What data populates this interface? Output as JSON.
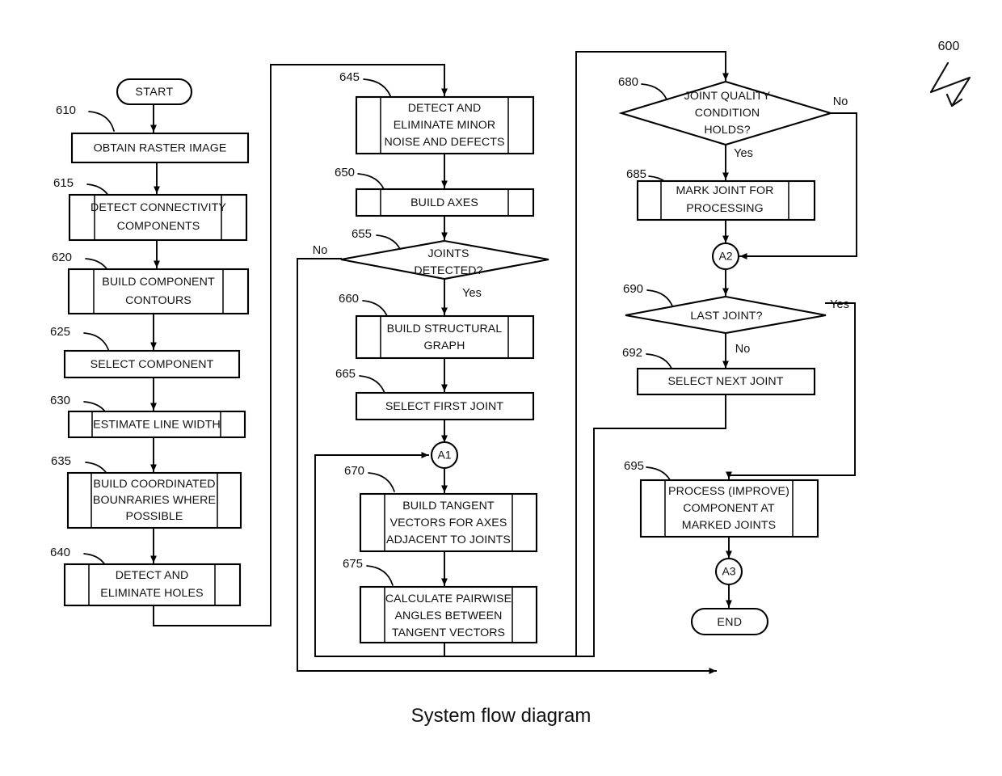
{
  "figure": {
    "number": "600",
    "caption": "System flow diagram"
  },
  "terminators": {
    "start": "START",
    "end": "END"
  },
  "connectors": [
    {
      "id": "A1",
      "label": "A1"
    },
    {
      "id": "A2",
      "label": "A2"
    },
    {
      "id": "A3",
      "label": "A3"
    }
  ],
  "edge_labels": {
    "joints_detected_no": "No",
    "joints_detected_yes": "Yes",
    "joint_quality_no": "No",
    "joint_quality_yes": "Yes",
    "last_joint_yes": "Yes",
    "last_joint_no": "No"
  },
  "nodes": [
    {
      "ref": "610",
      "shape": "process",
      "lines": [
        "OBTAIN RASTER IMAGE"
      ]
    },
    {
      "ref": "615",
      "shape": "predefined",
      "lines": [
        "DETECT CONNECTIVITY",
        "COMPONENTS"
      ]
    },
    {
      "ref": "620",
      "shape": "predefined",
      "lines": [
        "BUILD COMPONENT",
        "CONTOURS"
      ]
    },
    {
      "ref": "625",
      "shape": "process",
      "lines": [
        "SELECT COMPONENT"
      ]
    },
    {
      "ref": "630",
      "shape": "predefined",
      "lines": [
        "ESTIMATE LINE WIDTH"
      ]
    },
    {
      "ref": "635",
      "shape": "predefined",
      "lines": [
        "BUILD COORDINATED",
        "BOUNRARIES WHERE",
        "POSSIBLE"
      ]
    },
    {
      "ref": "640",
      "shape": "predefined",
      "lines": [
        "DETECT AND",
        "ELIMINATE HOLES"
      ]
    },
    {
      "ref": "645",
      "shape": "predefined",
      "lines": [
        "DETECT AND",
        "ELIMINATE MINOR",
        "NOISE AND DEFECTS"
      ]
    },
    {
      "ref": "650",
      "shape": "predefined",
      "lines": [
        "BUILD AXES"
      ]
    },
    {
      "ref": "655",
      "shape": "decision",
      "lines": [
        "JOINTS",
        "DETECTED?"
      ]
    },
    {
      "ref": "660",
      "shape": "predefined",
      "lines": [
        "BUILD STRUCTURAL",
        "GRAPH"
      ]
    },
    {
      "ref": "665",
      "shape": "process",
      "lines": [
        "SELECT FIRST JOINT"
      ]
    },
    {
      "ref": "670",
      "shape": "predefined",
      "lines": [
        "BUILD TANGENT",
        "VECTORS FOR AXES",
        "ADJACENT TO JOINTS"
      ]
    },
    {
      "ref": "675",
      "shape": "predefined",
      "lines": [
        "CALCULATE PAIRWISE",
        "ANGLES BETWEEN",
        "TANGENT VECTORS"
      ]
    },
    {
      "ref": "680",
      "shape": "decision",
      "lines": [
        "JOINT QUALITY",
        "CONDITION",
        "HOLDS?"
      ]
    },
    {
      "ref": "685",
      "shape": "predefined",
      "lines": [
        "MARK JOINT FOR",
        "PROCESSING"
      ]
    },
    {
      "ref": "690",
      "shape": "decision",
      "lines": [
        "LAST JOINT?"
      ]
    },
    {
      "ref": "692",
      "shape": "process",
      "lines": [
        "SELECT NEXT JOINT"
      ]
    },
    {
      "ref": "695",
      "shape": "predefined",
      "lines": [
        "PROCESS (IMPROVE)",
        "COMPONENT AT",
        "MARKED JOINTS"
      ]
    }
  ]
}
